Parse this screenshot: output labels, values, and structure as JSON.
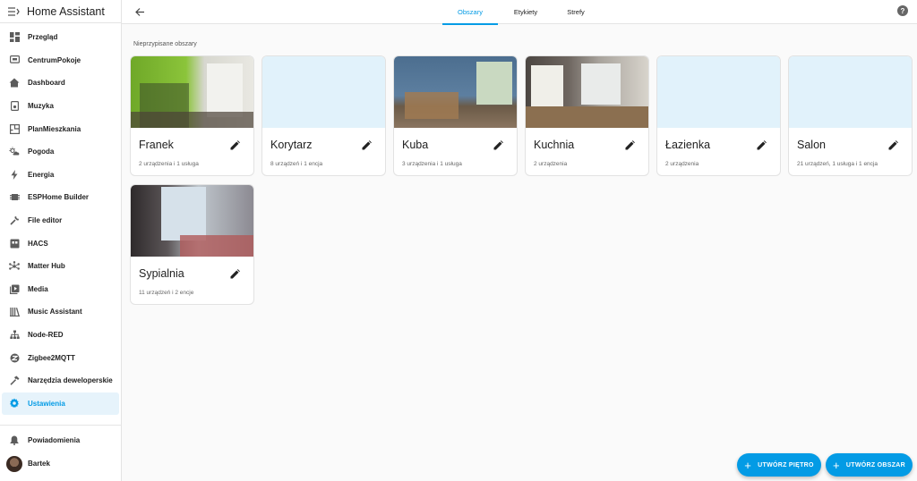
{
  "app": {
    "title": "Home Assistant"
  },
  "sidebar": {
    "items": [
      {
        "label": "Przegląd",
        "icon": "dashboard-grid-icon"
      },
      {
        "label": "CentrumPokoje",
        "icon": "monitor-icon"
      },
      {
        "label": "Dashboard",
        "icon": "home-icon"
      },
      {
        "label": "Muzyka",
        "icon": "speaker-icon"
      },
      {
        "label": "PlanMieszkania",
        "icon": "floorplan-icon"
      },
      {
        "label": "Pogoda",
        "icon": "weather-icon"
      },
      {
        "label": "Energia",
        "icon": "lightning-icon"
      },
      {
        "label": "ESPHome Builder",
        "icon": "chip-icon"
      },
      {
        "label": "File editor",
        "icon": "wrench-icon"
      },
      {
        "label": "HACS",
        "icon": "store-icon"
      },
      {
        "label": "Matter Hub",
        "icon": "hub-icon"
      },
      {
        "label": "Media",
        "icon": "play-box-icon"
      },
      {
        "label": "Music Assistant",
        "icon": "library-icon"
      },
      {
        "label": "Node-RED",
        "icon": "sitemap-icon"
      },
      {
        "label": "Zigbee2MQTT",
        "icon": "zigbee-icon"
      },
      {
        "label": "Narzędzia deweloperskie",
        "icon": "hammer-icon"
      },
      {
        "label": "Ustawienia",
        "icon": "gear-icon",
        "active": true
      }
    ],
    "notifications": "Powiadomienia",
    "user": "Bartek"
  },
  "tabs": [
    {
      "label": "Obszary",
      "active": true
    },
    {
      "label": "Etykiety"
    },
    {
      "label": "Strefy"
    }
  ],
  "main": {
    "section_title": "Nieprzypisane obszary",
    "areas": [
      {
        "name": "Franek",
        "summary": "2 urządzenia i 1 usługa"
      },
      {
        "name": "Korytarz",
        "summary": "8 urządzeń i 1 encja"
      },
      {
        "name": "Kuba",
        "summary": "3 urządzenia i 1 usługa"
      },
      {
        "name": "Kuchnia",
        "summary": "2 urządzenia"
      },
      {
        "name": "Łazienka",
        "summary": "2 urządzenia"
      },
      {
        "name": "Salon",
        "summary": "21 urządzeń, 1 usługa i 1 encja"
      },
      {
        "name": "Sypialnia",
        "summary": "11 urządzeń i 2 encje"
      }
    ]
  },
  "actions": {
    "create_floor": "UTWÓRZ PIĘTRO",
    "create_area": "UTWÓRZ OBSZAR"
  },
  "colors": {
    "accent": "#039be5",
    "placeholder_image": "#e1f2fb"
  }
}
